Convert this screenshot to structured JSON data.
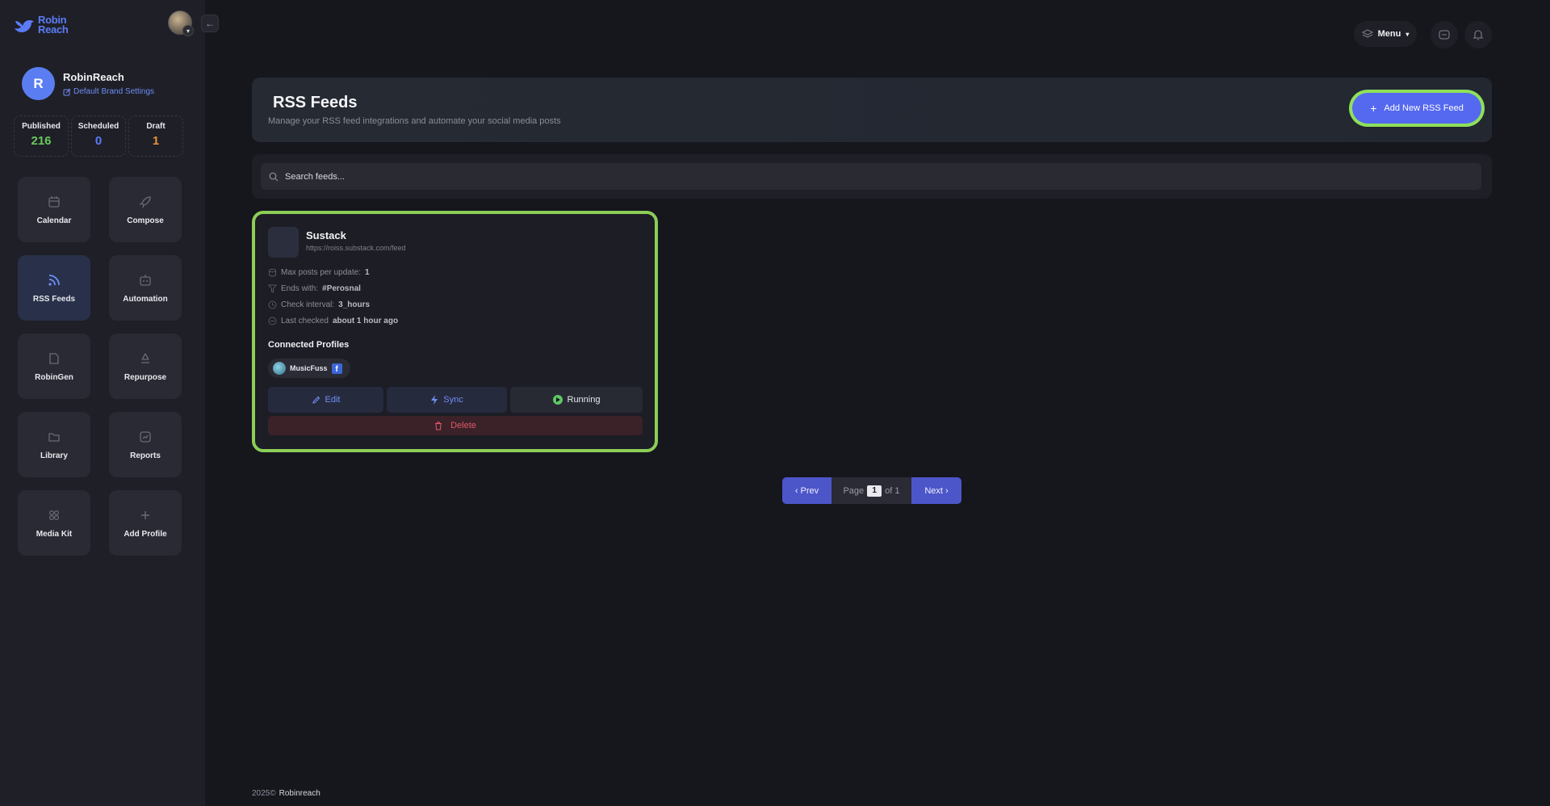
{
  "brand": {
    "name_line1": "Robin",
    "name_line2": "Reach"
  },
  "profile": {
    "initial": "R",
    "name": "RobinReach",
    "settings_link": "Default Brand Settings"
  },
  "stats": [
    {
      "label": "Published",
      "value": "216",
      "color": "#69c85a"
    },
    {
      "label": "Scheduled",
      "value": "0",
      "color": "#5b7cf5"
    },
    {
      "label": "Draft",
      "value": "1",
      "color": "#e8923a"
    }
  ],
  "nav": [
    {
      "label": "Calendar",
      "icon": "calendar-icon"
    },
    {
      "label": "Compose",
      "icon": "rocket-icon"
    },
    {
      "label": "RSS Feeds",
      "icon": "rss-icon",
      "active": true
    },
    {
      "label": "Automation",
      "icon": "robot-icon"
    },
    {
      "label": "RobinGen",
      "icon": "document-icon"
    },
    {
      "label": "Repurpose",
      "icon": "recycle-icon"
    },
    {
      "label": "Library",
      "icon": "folder-icon"
    },
    {
      "label": "Reports",
      "icon": "chart-icon"
    },
    {
      "label": "Media Kit",
      "icon": "grid-icon"
    },
    {
      "label": "Add Profile",
      "icon": "plus-icon"
    }
  ],
  "topbar": {
    "menu_label": "Menu"
  },
  "header": {
    "title": "RSS Feeds",
    "subtitle": "Manage your RSS feed integrations and automate your social media posts",
    "add_button": "Add New RSS Feed"
  },
  "search": {
    "placeholder": "Search feeds..."
  },
  "feed": {
    "title": "Sustack",
    "url": "https://roiss.substack.com/feed",
    "meta": {
      "max_posts_label": "Max posts per update:",
      "max_posts": "1",
      "ends_with_label": "Ends with:",
      "ends_with": "#Perosnal",
      "interval_label": "Check interval:",
      "interval": "3_hours",
      "last_checked_label": "Last checked",
      "last_checked": "about 1 hour ago"
    },
    "connected_title": "Connected Profiles",
    "profile_name": "MusicFuss",
    "edit": "Edit",
    "sync": "Sync",
    "status": "Running",
    "delete": "Delete"
  },
  "pagination": {
    "prev": "‹ Prev",
    "page_label": "Page",
    "current": "1",
    "of_label": "of 1",
    "next": "Next ›"
  },
  "footer": {
    "year": "2025©",
    "brand": "Robinreach"
  }
}
